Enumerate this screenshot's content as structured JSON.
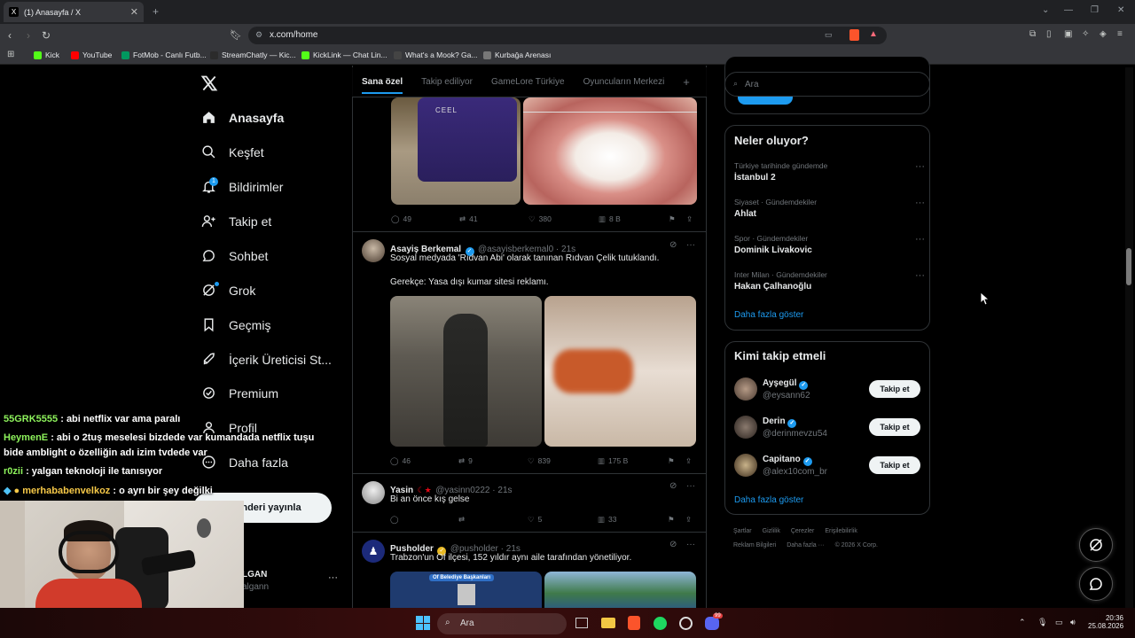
{
  "browser": {
    "tab_title": "(1) Anasayfa / X",
    "url": "x.com/home",
    "bookmarks": [
      {
        "label": "Kick",
        "color": "#53fc18"
      },
      {
        "label": "YouTube",
        "color": "#ff0000"
      },
      {
        "label": "FotMob - Canlı Futb...",
        "color": "#00985f"
      },
      {
        "label": "StreamChatly — Kic...",
        "color": "#2b2b2b"
      },
      {
        "label": "KickLink — Chat Lin...",
        "color": "#53fc18"
      },
      {
        "label": "What's a Mook? Ga...",
        "color": "#444444"
      },
      {
        "label": "Kurbağa Arenası",
        "color": "#777777"
      }
    ]
  },
  "x": {
    "nav": {
      "home": "Anasayfa",
      "explore": "Keşfet",
      "notifications": "Bildirimler",
      "notifications_badge": "1",
      "follow": "Takip et",
      "chat": "Sohbet",
      "grok": "Grok",
      "history": "Geçmiş",
      "creator": "İçerik Üreticisi St...",
      "premium": "Premium",
      "profile": "Profil",
      "more": "Daha fazla",
      "post_button": "Gönderiyi yayınla",
      "post_button_visible": "nderi yayınla",
      "account_name": "LGAN",
      "account_handle": "algann"
    },
    "tabs": [
      "Sana özel",
      "Takip ediliyor",
      "GameLore Türkiye",
      "Oyuncuların Merkezi"
    ],
    "tweets": [
      {
        "replies": "49",
        "retweets": "41",
        "likes": "380",
        "views": "8 B",
        "image_text": "CEEL"
      },
      {
        "name": "Asayiş Berkemal",
        "handle": "@asayisberkemal0 · 21s",
        "text1": "Sosyal medyada 'Rıdvan Abi' olarak tanınan Rıdvan Çelik tutuklandı.",
        "text2": "Gerekçe: Yasa dışı kumar sitesi reklamı.",
        "replies": "46",
        "retweets": "9",
        "likes": "839",
        "views": "175 B"
      },
      {
        "name": "Yasin",
        "handle": "@yasinn0222 · 21s",
        "text1": "Bi an önce kış gelse",
        "replies": "",
        "retweets": "",
        "likes": "5",
        "views": "33"
      },
      {
        "name": "Pusholder",
        "handle": "@pusholder · 21s",
        "text1": "Trabzon'un Of ilçesi, 152 yıldır aynı aile tarafından yönetiliyor.",
        "image_label": "Of Belediye Başkanları"
      }
    ],
    "search_placeholder": "Ara",
    "trends": {
      "title": "Neler oluyor?",
      "items": [
        {
          "meta": "Türkiye tarihinde gündemde",
          "name": "İstanbul 2"
        },
        {
          "meta": "Siyaset · Gündemdekiler",
          "name": "Ahlat"
        },
        {
          "meta": "Spor · Gündemdekiler",
          "name": "Dominik Livakovic"
        },
        {
          "meta": "Inter Milan · Gündemdekiler",
          "name": "Hakan Çalhanoğlu"
        }
      ],
      "show_more": "Daha fazla göster"
    },
    "who_to_follow": {
      "title": "Kimi takip etmeli",
      "users": [
        {
          "name": "Ayşegül",
          "handle": "@eysann62",
          "button": "Takip et"
        },
        {
          "name": "Derin",
          "handle": "@derinmevzu54",
          "button": "Takip et"
        },
        {
          "name": "Capitano",
          "handle": "@alex10com_br",
          "button": "Takip et"
        }
      ],
      "show_more": "Daha fazla göster"
    },
    "footer": {
      "line1": [
        "Şartlar",
        "Gizlilik",
        "Çerezler",
        "Erişilebilirlik"
      ],
      "line2": [
        "Reklam Bilgileri",
        "Daha fazla ···",
        "© 2026 X Corp."
      ]
    }
  },
  "stream_chat": [
    {
      "user": "55GRK5555",
      "msg": ": abi netflix var ama paralı"
    },
    {
      "user": "HeymenE",
      "msg": ": abi o 2tuş meselesi bizdede var kumandada netflix tuşu"
    },
    {
      "user": "",
      "msg": "bide amblight o özelliğin adı izim tvdede var"
    },
    {
      "user": "r0zii",
      "msg": ": yalgan teknoloji ile tanısıyor"
    },
    {
      "user": "merhababenvelkoz",
      "msg": ": o ayrı bir şey değilki"
    }
  ],
  "taskbar": {
    "search": "Ara",
    "time": "20:36",
    "date": "25.08.2026",
    "badge": "99"
  }
}
